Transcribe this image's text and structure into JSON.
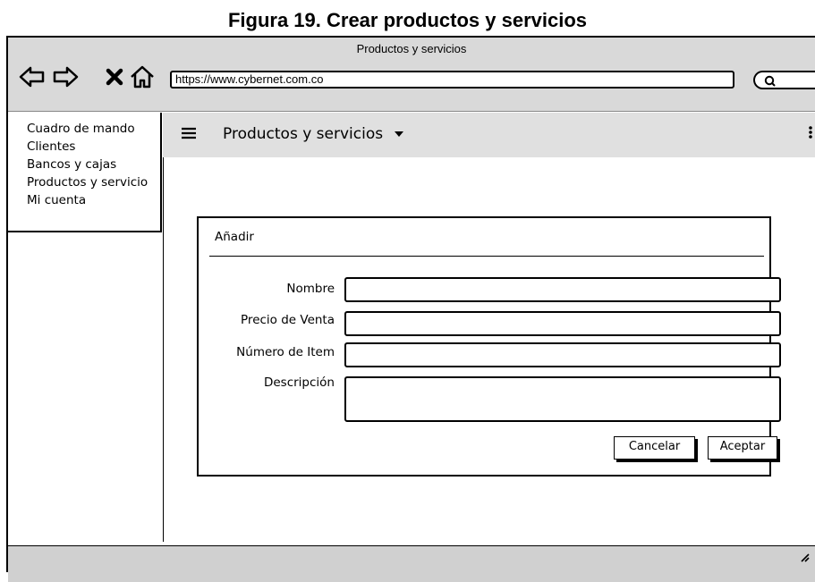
{
  "caption": "Figura 19. Crear productos y servicios",
  "browser": {
    "title": "Productos y servicios",
    "url": "https://www.cybernet.com.co",
    "nav_icons": [
      "back-arrow-icon",
      "forward-arrow-icon",
      "close-icon",
      "home-icon"
    ],
    "search_icon": "search-icon"
  },
  "sidebar": {
    "items": [
      {
        "label": "Cuadro de mando"
      },
      {
        "label": "Clientes"
      },
      {
        "label": "Bancos y cajas"
      },
      {
        "label": "Productos y servicio"
      },
      {
        "label": "Mi cuenta"
      }
    ]
  },
  "appbar": {
    "menu_icon": "hamburger-icon",
    "title": "Productos y servicios",
    "dropdown_icon": "caret-down-icon",
    "more_icon": "more-vertical-icon"
  },
  "dialog": {
    "title": "Añadir",
    "fields": [
      {
        "label": "Nombre",
        "value": ""
      },
      {
        "label": "Precio de Venta",
        "value": ""
      },
      {
        "label": "Número de Item",
        "value": ""
      },
      {
        "label": "Descripción",
        "value": ""
      }
    ],
    "cancel_label": "Cancelar",
    "accept_label": "Aceptar"
  }
}
